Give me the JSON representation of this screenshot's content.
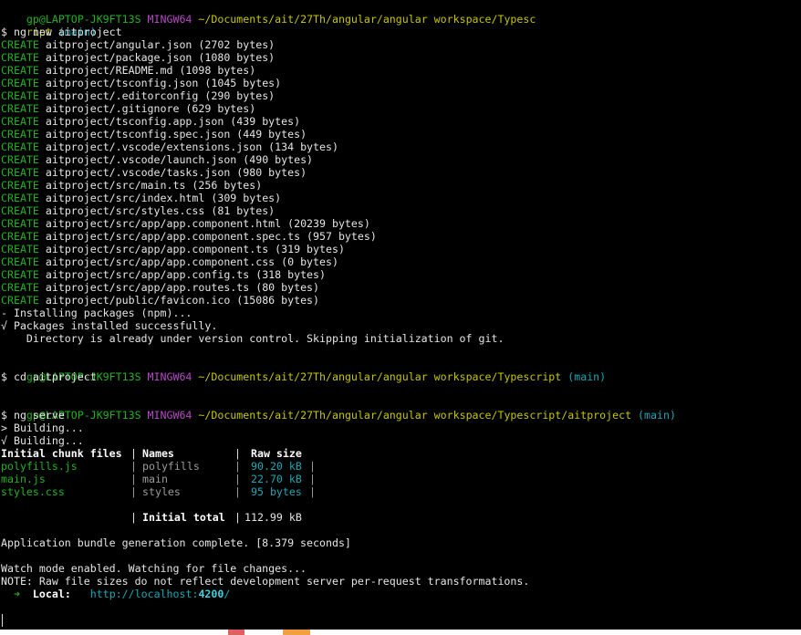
{
  "prompt1": {
    "user": "gp@LAPTOP-JK9FT13S",
    "shell": "MINGW64",
    "path_line1": "~/Documents/ait/27Th/angular/angular workspace/Typesc",
    "path_line2": "ript",
    "branch": "(main)"
  },
  "command1": "$ ng new aitproject",
  "create_label": "CREATE",
  "created_files": [
    "aitproject/angular.json (2702 bytes)",
    "aitproject/package.json (1080 bytes)",
    "aitproject/README.md (1098 bytes)",
    "aitproject/tsconfig.json (1045 bytes)",
    "aitproject/.editorconfig (290 bytes)",
    "aitproject/.gitignore (629 bytes)",
    "aitproject/tsconfig.app.json (439 bytes)",
    "aitproject/tsconfig.spec.json (449 bytes)",
    "aitproject/.vscode/extensions.json (134 bytes)",
    "aitproject/.vscode/launch.json (490 bytes)",
    "aitproject/.vscode/tasks.json (980 bytes)",
    "aitproject/src/main.ts (256 bytes)",
    "aitproject/src/index.html (309 bytes)",
    "aitproject/src/styles.css (81 bytes)",
    "aitproject/src/app/app.component.html (20239 bytes)",
    "aitproject/src/app/app.component.spec.ts (957 bytes)",
    "aitproject/src/app/app.component.ts (319 bytes)",
    "aitproject/src/app/app.component.css (0 bytes)",
    "aitproject/src/app/app.config.ts (318 bytes)",
    "aitproject/src/app/app.routes.ts (80 bytes)",
    "aitproject/public/favicon.ico (15086 bytes)"
  ],
  "installing": "- Installing packages (npm)...",
  "installed": "√ Packages installed successfully.",
  "skip_git": "    Directory is already under version control. Skipping initialization of git.",
  "prompt2": {
    "user": "gp@LAPTOP-JK9FT13S",
    "shell": "MINGW64",
    "path": "~/Documents/ait/27Th/angular/angular workspace/Typescript",
    "branch": "(main)"
  },
  "command2": "$ cd aitproject",
  "prompt3": {
    "user": "gp@LAPTOP-JK9FT13S",
    "shell": "MINGW64",
    "path": "~/Documents/ait/27Th/angular/angular workspace/Typescript/aitproject",
    "branch": "(main)"
  },
  "command3": "$ ng serve",
  "building1": "> Building...",
  "building2": "√ Building...",
  "bundle_table": {
    "headers": [
      "Initial chunk files",
      "|",
      "Names",
      "|",
      "Raw size"
    ],
    "rows": [
      {
        "file": "polyfills.js",
        "name": "polyfills",
        "size": "90.20 kB"
      },
      {
        "file": "main.js",
        "name": "main",
        "size": "22.70 kB"
      },
      {
        "file": "styles.css",
        "name": "styles",
        "size": "95 bytes"
      }
    ],
    "sep": "|",
    "total_label": "Initial total",
    "total_value": "112.99 kB"
  },
  "bundle_complete": "Application bundle generation complete. [8.379 seconds]",
  "watch_mode": "Watch mode enabled. Watching for file changes...",
  "note": "NOTE: Raw file sizes do not reflect development server per-request transformations.",
  "local": {
    "arrow": "➜",
    "label": "Local:",
    "url_prefix": "http://localhost:",
    "url_port": "4200",
    "url_suffix": "/"
  },
  "colors": {
    "background": "#000000",
    "green": "#1fb31f",
    "purple": "#b548c6",
    "yellow": "#c5c500",
    "cyan": "#18a7b5"
  }
}
